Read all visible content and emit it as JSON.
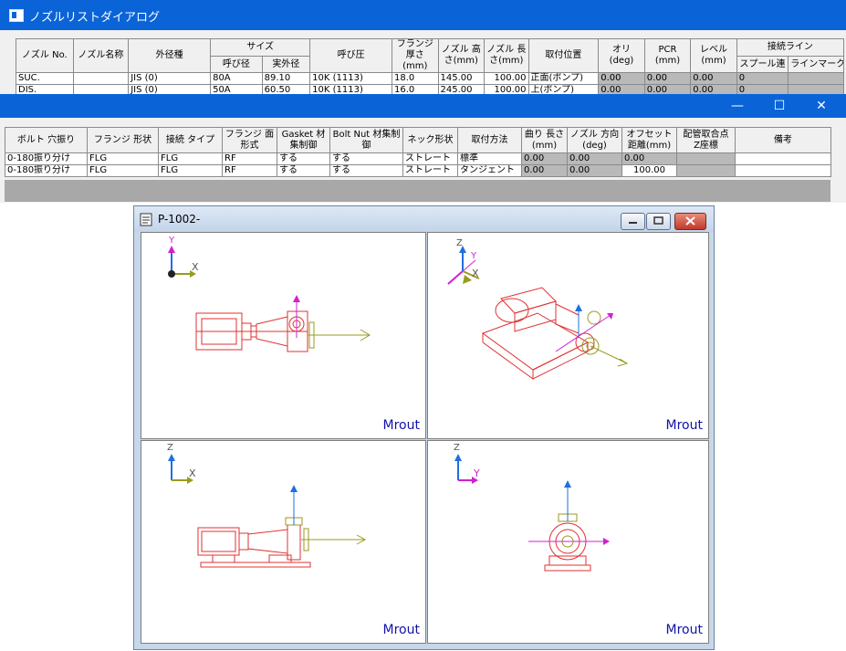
{
  "dialog": {
    "title": "ノズルリストダイアログ",
    "headers": {
      "nozzle_no": "ノズル No.",
      "nozzle_name": "ノズル名称",
      "outer_type": "外径種",
      "size": "サイズ",
      "nominal": "呼び径",
      "actual_od": "実外径",
      "pressure": "呼び圧",
      "flange_thickness": "フランジ 厚さ(mm)",
      "nozzle_height": "ノズル 高さ(mm)",
      "nozzle_length": "ノズル 長さ(mm)",
      "position": "取付位置",
      "ori": "オリ (deg)",
      "pcr": "PCR (mm)",
      "level": "レベル (mm)",
      "line": "接続ライン",
      "spool": "スプール連",
      "line_mark": "ラインマーク"
    },
    "rows": [
      {
        "no": "SUC.",
        "name": "",
        "type": "JIS (0)",
        "nominal": "80A",
        "od": "89.10",
        "pressure": "10K (1113)",
        "flange": "18.0",
        "height": "145.00",
        "length": "100.00",
        "position": "正面(ポンプ)",
        "ori": "0.00",
        "pcr": "0.00",
        "level": "0.00",
        "spool": "0"
      },
      {
        "no": "DIS.",
        "name": "",
        "type": "JIS (0)",
        "nominal": "50A",
        "od": "60.50",
        "pressure": "10K (1113)",
        "flange": "16.0",
        "height": "245.00",
        "length": "100.00",
        "position": "上(ポンプ)",
        "ori": "0.00",
        "pcr": "0.00",
        "level": "0.00",
        "spool": "0"
      }
    ]
  },
  "window2": {
    "minimize": "—",
    "maximize": "☐",
    "close": "✕",
    "headers": {
      "bolt": "ボルト 穴振り",
      "flange_shape": "フランジ 形状",
      "conn_type": "接続 タイプ",
      "flange_face": "フランジ 面形式",
      "gasket": "Gasket 材集制御",
      "bolt_nut": "Bolt Nut 材集制御",
      "neck": "ネック形状",
      "method": "取付方法",
      "bend_len": "曲り 長さ(mm)",
      "nozzle_dir": "ノズル 方向(deg)",
      "offset": "オフセット 距離(mm)",
      "z_coord": "配管取合点 Z座標",
      "remarks": "備考"
    },
    "rows": [
      {
        "bolt": "0-180振り分け",
        "shape": "FLG",
        "type": "FLG",
        "face": "RF",
        "gasket": "する",
        "boltnut": "する",
        "neck": "ストレート",
        "method": "標準",
        "bend": "0.00",
        "dir": "0.00",
        "offset": "0.00",
        "z": "",
        "remarks": ""
      },
      {
        "bolt": "0-180振り分け",
        "shape": "FLG",
        "type": "FLG",
        "face": "RF",
        "gasket": "する",
        "boltnut": "する",
        "neck": "ストレート",
        "method": "タンジェント",
        "bend": "0.00",
        "dir": "0.00",
        "offset": "100.00",
        "z": "",
        "remarks": ""
      }
    ]
  },
  "cad": {
    "title": "P-1002-",
    "viewports": [
      {
        "axis_a": "Y",
        "axis_b": "X",
        "label": "Mrout"
      },
      {
        "axis_a": "Z",
        "axis_b": "Y",
        "axis_c": "X",
        "label": "Mrout"
      },
      {
        "axis_a": "Z",
        "axis_b": "X",
        "label": "Mrout"
      },
      {
        "axis_a": "Z",
        "axis_b": "Y",
        "label": "Mrout"
      }
    ]
  },
  "colors": {
    "title_blue": "#0a64d8",
    "pump_red": "#e03030",
    "olive": "#9a9a20",
    "axis_blue": "#1e6fe0",
    "axis_magenta": "#d020d0"
  }
}
